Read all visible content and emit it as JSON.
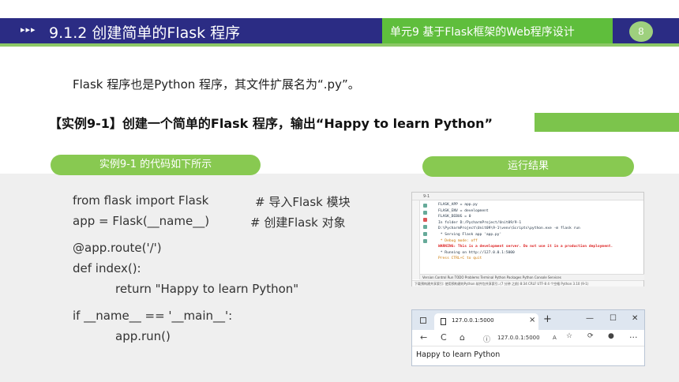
{
  "header": {
    "arrows": "▸▸▸",
    "section_title": "9.1.2   创建简单的Flask 程序",
    "unit_title": "单元9  基于Flask框架的Web程序设计",
    "page_number": "8"
  },
  "intro": "Flask 程序也是Python 程序，其文件扩展名为“.py”。",
  "example_title": "【实例9-1】创建一个简单的Flask 程序，输出“Happy to learn Python”",
  "labels": {
    "code_label": "实例9-1 的代码如下所示",
    "result_label": "运行结果"
  },
  "code": {
    "line1": "from flask import Flask",
    "comment1": "# 导入Flask 模块",
    "line2": "app = Flask(__name__)",
    "comment2": "# 创建Flask 对象",
    "line3": "@app.route('/')",
    "line4": "def index():",
    "line5": "return \"Happy to learn Python\"",
    "line6": "if __name__ == '__main__':",
    "line7": "app.run()"
  },
  "ide": {
    "head": "9-1",
    "console": [
      "FLASK_APP = app.py",
      "FLASK_ENV = development",
      "FLASK_DEBUG = 0",
      "In folder D:/PycharmProject/Unit09/9-1",
      "D:\\PycharmProject\\Unit09\\9-1\\venv\\Scripts\\python.exe -m flask run",
      " * Serving Flask app 'app.py'",
      " * Debug mode: off",
      "WARNING: This is a development server. Do not use it in a production deployment.",
      " * Running on http://127.0.0.1:5000",
      "Press CTRL+C to quit"
    ],
    "toolbar": "Version Control    Run    TODO    Problems    Terminal    Python Packages    Python Console    Services",
    "statusbar": "下载预构建共享索引: 使用预构建的Python 软件包共享索引..(7 分钟 之前)    8:34   CRLF   UTF-8   4 个空格   Python 3.10 (9-1)"
  },
  "browser": {
    "tab_title": "127.0.0.1:5000",
    "tab_close": "×",
    "new_tab": "+",
    "minimize": "—",
    "maximize": "☐",
    "close": "✕",
    "back": "←",
    "reload": "C",
    "home": "⌂",
    "url": "127.0.0.1:5000",
    "more": "···",
    "page_text": "Happy to learn Python"
  }
}
